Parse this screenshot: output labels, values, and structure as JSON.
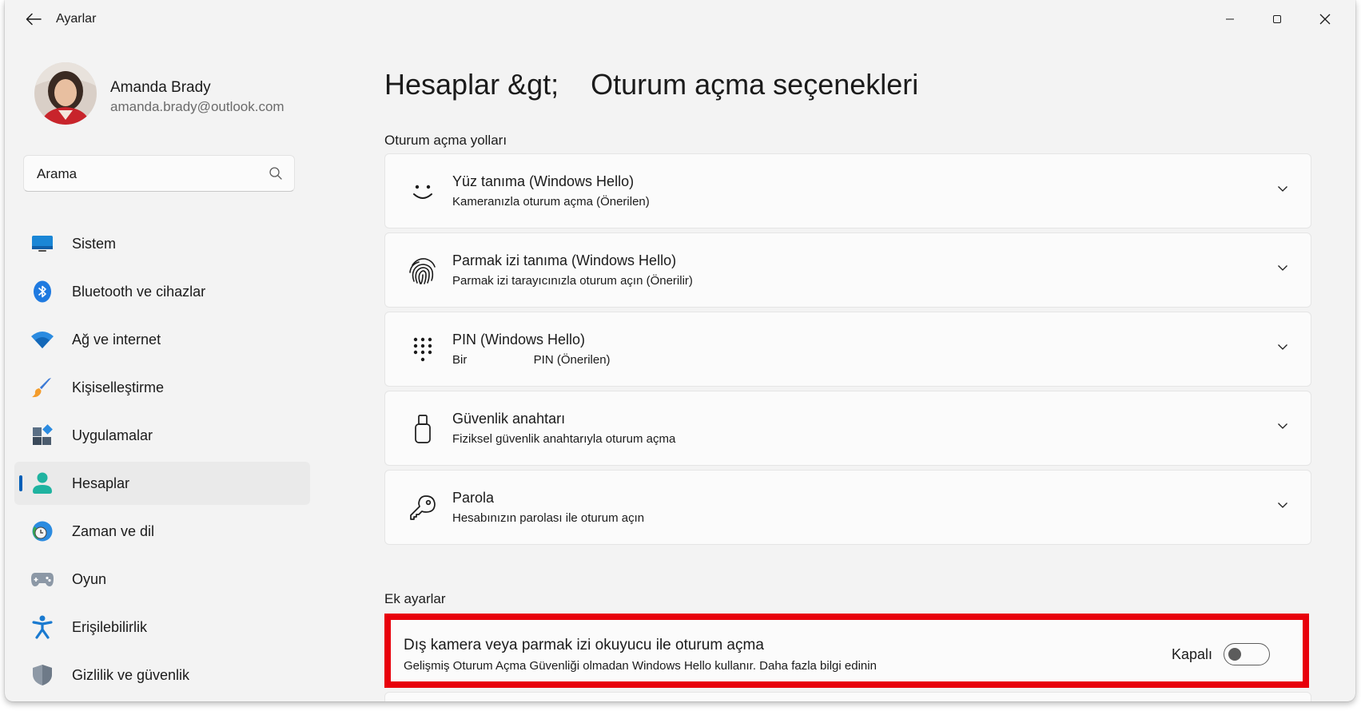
{
  "window": {
    "title": "Ayarlar"
  },
  "user": {
    "name": "Amanda Brady",
    "email": "amanda.brady@outlook.com"
  },
  "search": {
    "placeholder": "Arama"
  },
  "sidebar": {
    "items": [
      {
        "label": "Sistem",
        "icon": "monitor-icon"
      },
      {
        "label": "Bluetooth ve cihazlar",
        "icon": "bluetooth-icon"
      },
      {
        "label": "Ağ ve internet",
        "icon": "wifi-icon"
      },
      {
        "label": "Kişiselleştirme",
        "icon": "brush-icon"
      },
      {
        "label": "Uygulamalar",
        "icon": "apps-icon"
      },
      {
        "label": "Hesaplar",
        "icon": "person-icon",
        "active": true
      },
      {
        "label": "Zaman ve dil",
        "icon": "clock-globe-icon"
      },
      {
        "label": "Oyun",
        "icon": "gamepad-icon"
      },
      {
        "label": "Erişilebilirlik",
        "icon": "accessibility-icon"
      },
      {
        "label": "Gizlilik ve güvenlik",
        "icon": "shield-icon"
      }
    ]
  },
  "main": {
    "title": "Hesaplar &gt;    Oturum açma seçenekleri",
    "section_signin": "Oturum açma yolları",
    "cards": [
      {
        "title": "Yüz tanıma (Windows Hello)",
        "subtitle": "Kameranızla oturum açma (Önerilen)",
        "icon": "smile-face-icon"
      },
      {
        "title": "Parmak izi tanıma (Windows Hello)",
        "subtitle": "Parmak izi tarayıcınızla oturum açın (Önerilir)",
        "icon": "fingerprint-icon"
      },
      {
        "title": "PIN (Windows Hello)",
        "subtitle": "Bir                    PIN (Önerilen)",
        "icon": "keypad-icon"
      },
      {
        "title": "Güvenlik anahtarı",
        "subtitle": "Fiziksel güvenlik anahtarıyla oturum açma",
        "icon": "usb-key-icon"
      },
      {
        "title": "Parola",
        "subtitle": "Hesabınızın parolası ile oturum açın",
        "icon": "key-icon"
      }
    ],
    "section_additional": "Ek ayarlar",
    "external": {
      "title": "Dış kamera veya parmak izi okuyucu ile oturum açma",
      "subtitle": "Gelişmiş Oturum Açma Güvenliği olmadan Windows Hello kullanır. Daha fazla bilgi edinin",
      "toggle_label": "Kapalı",
      "toggle_on": false
    }
  },
  "colors": {
    "accent": "#005fb8",
    "highlight": "#e8000b"
  }
}
